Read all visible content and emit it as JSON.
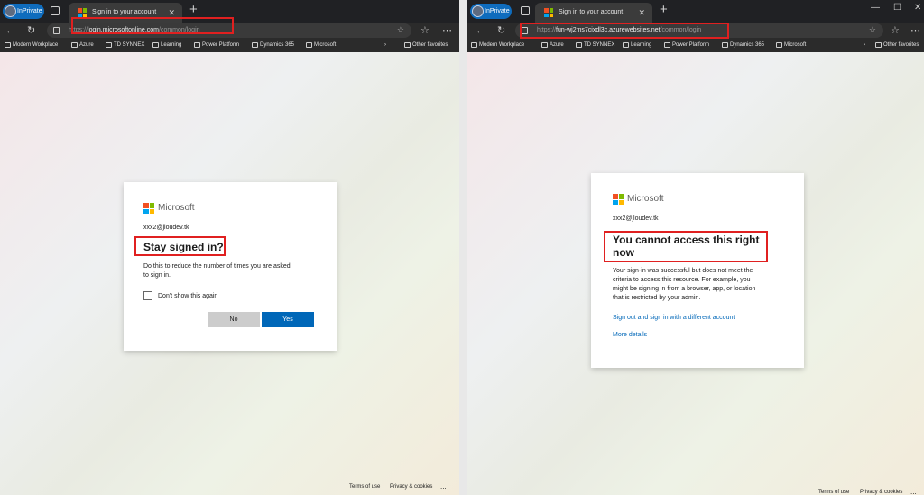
{
  "left": {
    "tabbar": {
      "inprivate": "InPrivate",
      "tab_title": "Sign in to your account"
    },
    "address": {
      "scheme": "https://",
      "host": "login.microsoftonline.com",
      "path": "/common/login"
    },
    "bookmarks": [
      "Modern Workplace",
      "Azure",
      "TD SYNNEX",
      "Learning",
      "Power Platform",
      "Dynamics 365",
      "Microsoft"
    ],
    "other_favorites": "Other favorites",
    "card": {
      "brand": "Microsoft",
      "email": "xxx2@jloudev.tk",
      "title": "Stay signed in?",
      "body_line1": "Do this to reduce the number of times you are asked",
      "body_line2": "to sign in.",
      "checkbox_label": "Don't show this again",
      "no_label": "No",
      "yes_label": "Yes"
    },
    "footer": {
      "terms": "Terms of use",
      "privacy": "Privacy & cookies",
      "more": "..."
    }
  },
  "right": {
    "tabbar": {
      "inprivate": "InPrivate",
      "tab_title": "Sign in to your account"
    },
    "address": {
      "scheme": "https://",
      "host": "fun-wj2ms7cixdl3c.azurewebsites.net",
      "path": "/common/login"
    },
    "bookmarks": [
      "Modern Workplace",
      "Azure",
      "TD SYNNEX",
      "Learning",
      "Power Platform",
      "Dynamics 365",
      "Microsoft"
    ],
    "other_favorites": "Other favorites",
    "card": {
      "brand": "Microsoft",
      "email": "xxx2@jloudev.tk",
      "title_line1": "You cannot access this right",
      "title_line2": "now",
      "body_lines": [
        "Your sign-in was successful but does not meet the",
        "criteria to access this resource. For example, you",
        "might be signing in from a browser, app, or location",
        "that is restricted by your admin."
      ],
      "signout_link": "Sign out and sign in with a different account",
      "more_details": "More details"
    },
    "footer": {
      "terms": "Terms of use",
      "privacy": "Privacy & cookies",
      "more": "..."
    }
  },
  "colors": {
    "accent": "#0067b8",
    "highlight": "#e02020",
    "ms_red": "#f25022",
    "ms_green": "#7fba00",
    "ms_blue": "#00a4ef",
    "ms_yellow": "#ffb900"
  },
  "icons": [
    "profile-avatar-icon",
    "tab-actions-icon",
    "microsoft-logo-icon",
    "close-icon",
    "new-tab-icon",
    "back-icon",
    "refresh-icon",
    "lock-icon",
    "favorite-star-icon",
    "favorites-icon",
    "more-icon",
    "folder-icon",
    "chevron-right-icon",
    "minimize-icon",
    "maximize-icon"
  ]
}
